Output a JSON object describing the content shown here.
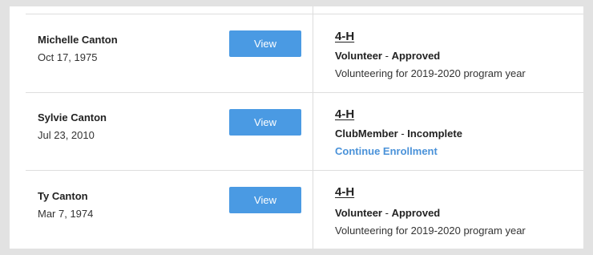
{
  "rows": [
    {
      "name": "Michelle Canton",
      "dob": "Oct 17, 1975",
      "view_label": "View",
      "program": "4-H",
      "role": "Volunteer",
      "separator": " - ",
      "status": "Approved",
      "detail": "Volunteering for 2019-2020 program year"
    },
    {
      "name": "Sylvie Canton",
      "dob": "Jul 23, 2010",
      "view_label": "View",
      "program": "4-H",
      "role": "ClubMember",
      "separator": " - ",
      "status": "Incomplete",
      "link": "Continue Enrollment"
    },
    {
      "name": "Ty Canton",
      "dob": "Mar 7, 1974",
      "view_label": "View",
      "program": "4-H",
      "role": "Volunteer",
      "separator": " - ",
      "status": "Approved",
      "detail": "Volunteering for 2019-2020 program year"
    }
  ],
  "colors": {
    "button": "#4a9ae3",
    "link": "#4a92d9",
    "page_background": "#e2e2e2"
  }
}
